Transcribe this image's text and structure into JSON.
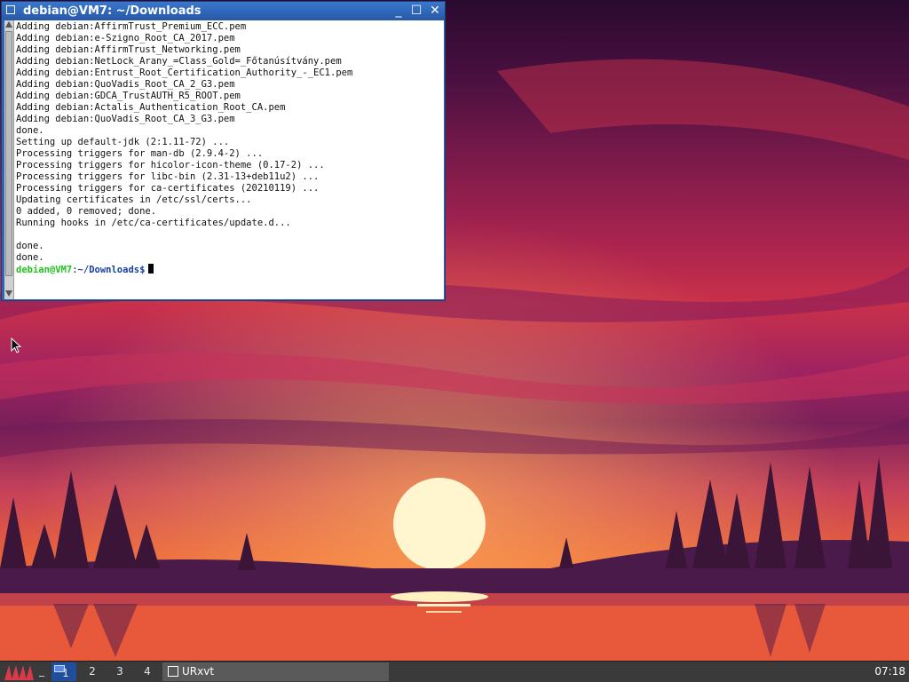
{
  "window": {
    "title": "debian@VM7: ~/Downloads",
    "minimize_glyph": "_",
    "maximize_glyph": "☐",
    "close_glyph": "✕"
  },
  "terminal": {
    "lines": [
      "Adding debian:AffirmTrust_Premium_ECC.pem",
      "Adding debian:e-Szigno_Root_CA_2017.pem",
      "Adding debian:AffirmTrust_Networking.pem",
      "Adding debian:NetLock_Arany_=Class_Gold=_Főtanúsítvány.pem",
      "Adding debian:Entrust_Root_Certification_Authority_-_EC1.pem",
      "Adding debian:QuoVadis_Root_CA_2_G3.pem",
      "Adding debian:GDCA_TrustAUTH_R5_ROOT.pem",
      "Adding debian:Actalis_Authentication_Root_CA.pem",
      "Adding debian:QuoVadis_Root_CA_3_G3.pem",
      "done.",
      "Setting up default-jdk (2:1.11-72) ...",
      "Processing triggers for man-db (2.9.4-2) ...",
      "Processing triggers for hicolor-icon-theme (0.17-2) ...",
      "Processing triggers for libc-bin (2.31-13+deb11u2) ...",
      "Processing triggers for ca-certificates (20210119) ...",
      "Updating certificates in /etc/ssl/certs...",
      "0 added, 0 removed; done.",
      "Running hooks in /etc/ca-certificates/update.d...",
      "",
      "done.",
      "done."
    ],
    "prompt_user": "debian@VM7",
    "prompt_sep": ":",
    "prompt_path": "~/Downloads",
    "prompt_symbol": "$"
  },
  "taskbar": {
    "show_desktop_glyph": "_",
    "workspaces": [
      {
        "label": "1",
        "active": true
      },
      {
        "label": "2",
        "active": false
      },
      {
        "label": "3",
        "active": false
      },
      {
        "label": "4",
        "active": false
      }
    ],
    "task_label": "URxvt",
    "clock": "07:18",
    "colors": {
      "bar": "#3a3a3a",
      "active_workspace": "#1f4f9c"
    }
  },
  "icons": {
    "menu": "debian-menu-logo-icon",
    "pointer": "mouse-pointer-icon",
    "terminal": "terminal-window-icon"
  }
}
